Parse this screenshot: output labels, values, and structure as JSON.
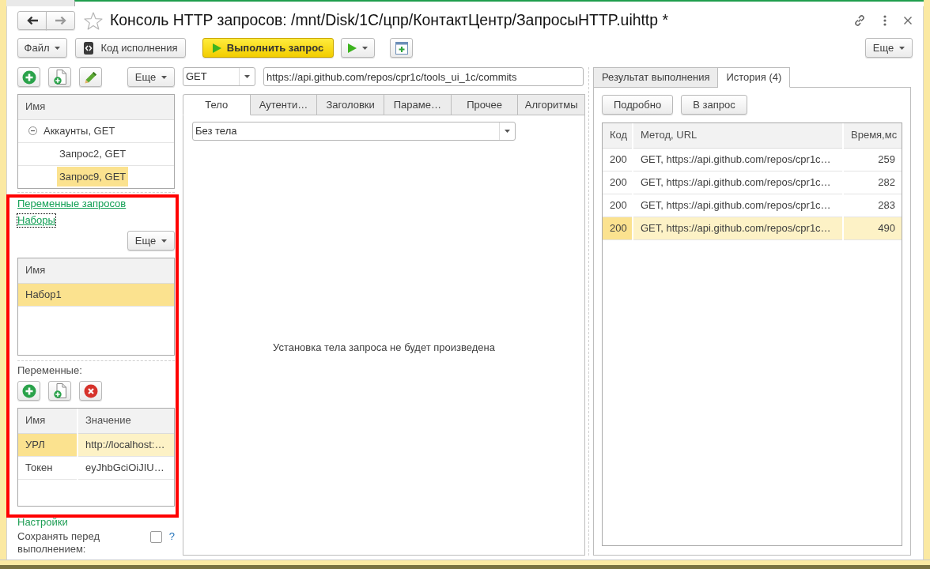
{
  "window": {
    "title": "Консоль HTTP запросов: /mnt/Disk/1C/цпр/КонтактЦентр/ЗапросыHTTP.uihttp *"
  },
  "toolbar": {
    "buttons": [
      {
        "kind": "menu",
        "label": "Файл"
      },
      {
        "kind": "code",
        "label": "Код исполнения"
      },
      {
        "kind": "run",
        "label": "Выполнить запрос"
      },
      {
        "kind": "run-menu"
      },
      {
        "kind": "form"
      }
    ],
    "more": "Еще"
  },
  "requests": {
    "tools": [
      {
        "kind": "add"
      },
      {
        "kind": "copy"
      },
      {
        "kind": "edit"
      }
    ],
    "more": "Еще",
    "column": "Имя",
    "tree": [
      {
        "label": "Аккаунты, GET",
        "expanded": true,
        "selected": false,
        "children": [
          {
            "label": "Запрос2, GET",
            "selected": false
          },
          {
            "label": "Запрос9, GET",
            "selected": true
          }
        ]
      }
    ]
  },
  "sets_panel": {
    "highlighted": true,
    "links": [
      {
        "label": "Переменные запросов",
        "focused": false
      },
      {
        "label": "Наборы",
        "focused": true
      }
    ],
    "more": "Еще",
    "sets": {
      "column": "Имя",
      "rows": [
        {
          "name": "Набор1",
          "selected": true
        }
      ]
    },
    "variables": {
      "label": "Переменные:",
      "tools": [
        {
          "kind": "add"
        },
        {
          "kind": "copy"
        },
        {
          "kind": "delete"
        }
      ],
      "columns": [
        "Имя",
        "Значение"
      ],
      "rows": [
        {
          "name": "УРЛ",
          "value": "http://localhost:…",
          "selected": true
        },
        {
          "name": "Токен",
          "value": "eyJhbGciOiJIU…",
          "selected": false
        }
      ]
    }
  },
  "settings": {
    "title": "Настройки",
    "save_before_run": {
      "label": "Сохранять перед выполнением:",
      "checked": false,
      "help": "?"
    }
  },
  "request": {
    "method": "GET",
    "url": "https://api.github.com/repos/cpr1c/tools_ui_1c/commits",
    "tabs": [
      {
        "label": "Тело",
        "selected": true
      },
      {
        "label": "Аутенти…",
        "selected": false
      },
      {
        "label": "Заголовки",
        "selected": false
      },
      {
        "label": "Параме…",
        "selected": false
      },
      {
        "label": "Прочее",
        "selected": false
      },
      {
        "label": "Алгоритмы",
        "selected": false
      }
    ],
    "body_type": "Без тела",
    "body_note": "Установка тела запроса не будет произведена"
  },
  "results": {
    "tabs": [
      {
        "label": "Результат выполнения",
        "selected": false
      },
      {
        "label": "История (4)",
        "selected": true
      }
    ],
    "buttons": [
      "Подробно",
      "В запрос"
    ],
    "columns": [
      "Код",
      "Метод, URL",
      "Время,мс"
    ],
    "rows": [
      {
        "code": "200",
        "request": "GET, https://api.github.com/repos/cpr1c…",
        "time": "259",
        "selected": false
      },
      {
        "code": "200",
        "request": "GET, https://api.github.com/repos/cpr1c…",
        "time": "282",
        "selected": false
      },
      {
        "code": "200",
        "request": "GET, https://api.github.com/repos/cpr1c…",
        "time": "283",
        "selected": false
      },
      {
        "code": "200",
        "request": "GET, https://api.github.com/repos/cpr1c…",
        "time": "490",
        "selected": true
      }
    ]
  }
}
